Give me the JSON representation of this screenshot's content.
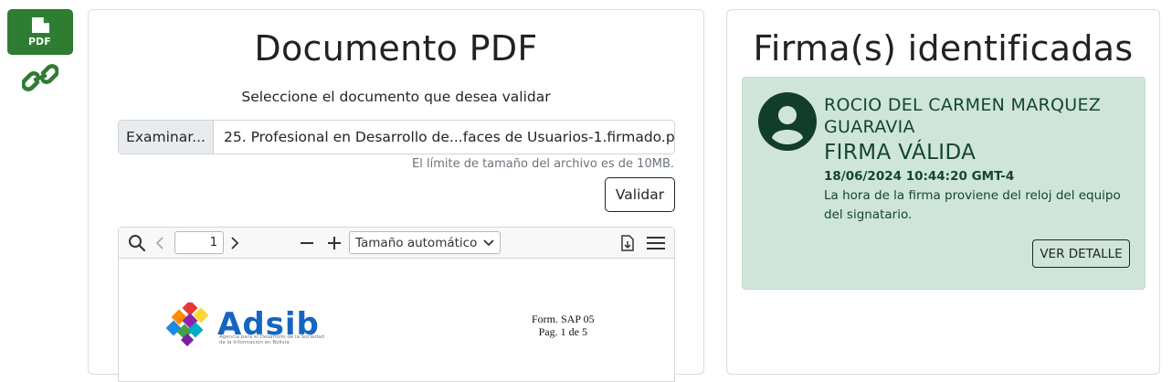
{
  "sidebar": {
    "pdf_label": "PDF",
    "items": [
      {
        "icon": "pdf-file-icon"
      },
      {
        "icon": "link-icon"
      }
    ],
    "accent_color": "#2e7d32"
  },
  "document_panel": {
    "title": "Documento PDF",
    "select_label": "Seleccione el documento que desea validar",
    "browse_label": "Examinar...",
    "file_name": "25. Profesional en Desarrollo de...faces de Usuarios-1.firmado.pdf",
    "size_limit": "El límite de tamaño del archivo es de 10MB.",
    "validate_label": "Validar"
  },
  "viewer": {
    "page_number": "1",
    "zoom": "Tamaño automático",
    "logo_text": "Adsib",
    "logo_subtitle": "Agencia para el Desarrollo de la Sociedad de la Información en Bolivia",
    "form_code": "Form. SAP 05",
    "page_info": "Pag. 1 de 5"
  },
  "signatures_panel": {
    "title": "Firma(s) identificadas",
    "signatures": [
      {
        "name": "ROCIO DEL CARMEN MARQUEZ GUARAVIA",
        "status": "FIRMA VÁLIDA",
        "date": "18/06/2024 10:44:20 GMT-4",
        "note": "La hora de la firma proviene del reloj del equipo del signatario.",
        "detail_label": "VER DETALLE",
        "card_color": "#d0e5da",
        "text_color": "#14452f"
      }
    ]
  }
}
